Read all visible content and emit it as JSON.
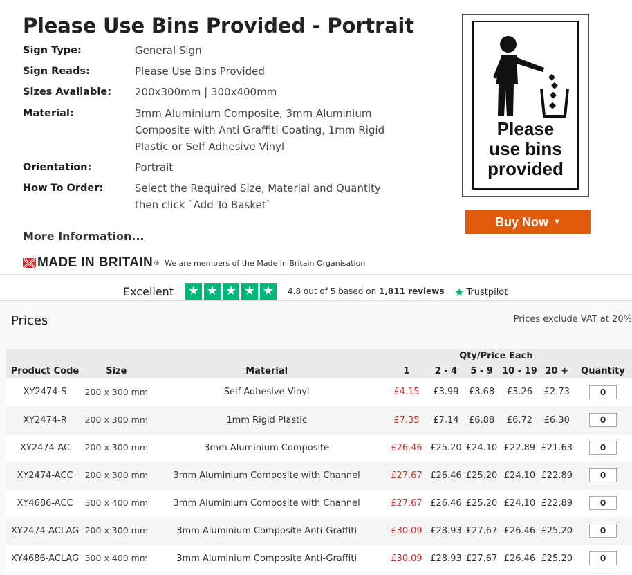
{
  "product": {
    "title": "Please Use Bins Provided - Portrait",
    "details": [
      {
        "label": "Sign Type:",
        "value": "General Sign"
      },
      {
        "label": "Sign Reads:",
        "value": "Please Use Bins Provided"
      },
      {
        "label": "Sizes Available:",
        "value": "200x300mm | 300x400mm"
      },
      {
        "label": "Material:",
        "value": "3mm Aluminium Composite, 3mm Aluminium Composite with Anti Graffiti Coating, 1mm Rigid Plastic or Self Adhesive Vinyl"
      },
      {
        "label": "Orientation:",
        "value": "Portrait"
      },
      {
        "label": "How To Order:",
        "value": "Select the Required Size, Material and Quantity then click `Add To Basket`"
      }
    ],
    "more_info": "More Information...",
    "sign_text_line1": "Please",
    "sign_text_line2": "use bins",
    "sign_text_line3": "provided",
    "buy_button": "Buy Now",
    "buy_icon": "caret-down-icon"
  },
  "made_in_britain": {
    "logo": "MADE IN BRITAIN",
    "reg": "®",
    "text": "We are members of the Made in Britain Organisation"
  },
  "trustpilot": {
    "rating_word": "Excellent",
    "stars": 5,
    "score_prefix": "4.8 out of 5 based on",
    "review_count": "1,811 reviews",
    "brand": "Trustpilot",
    "color": "#00b67a"
  },
  "prices": {
    "title": "Prices",
    "vat_note": "Prices exclude VAT at 20%",
    "group_header": "Qty/Price Each",
    "columns": [
      "Product Code",
      "Size",
      "Material",
      "1",
      "2 - 4",
      "5 - 9",
      "10 - 19",
      "20 +",
      "Quantity"
    ],
    "rows": [
      {
        "code": "XY2474-S",
        "size": "200 x 300 mm",
        "material": "Self Adhesive Vinyl",
        "p1": "£4.15",
        "p2": "£3.99",
        "p3": "£3.68",
        "p4": "£3.26",
        "p5": "£2.73",
        "qty": "0"
      },
      {
        "code": "XY2474-R",
        "size": "200 x 300 mm",
        "material": "1mm Rigid Plastic",
        "p1": "£7.35",
        "p2": "£7.14",
        "p3": "£6.88",
        "p4": "£6.72",
        "p5": "£6.30",
        "qty": "0"
      },
      {
        "code": "XY2474-AC",
        "size": "200 x 300 mm",
        "material": "3mm Aluminium Composite",
        "p1": "£26.46",
        "p2": "£25.20",
        "p3": "£24.10",
        "p4": "£22.89",
        "p5": "£21.63",
        "qty": "0"
      },
      {
        "code": "XY2474-ACC",
        "size": "200 x 300 mm",
        "material": "3mm Aluminium Composite with Channel",
        "p1": "£27.67",
        "p2": "£26.46",
        "p3": "£25.20",
        "p4": "£24.10",
        "p5": "£22.89",
        "qty": "0"
      },
      {
        "code": "XY4686-ACC",
        "size": "300 x 400 mm",
        "material": "3mm Aluminium Composite with Channel",
        "p1": "£27.67",
        "p2": "£26.46",
        "p3": "£25.20",
        "p4": "£24.10",
        "p5": "£22.89",
        "qty": "0"
      },
      {
        "code": "XY2474-ACLAG",
        "size": "200 x 300 mm",
        "material": "3mm Aluminium Composite Anti-Graffiti",
        "p1": "£30.09",
        "p2": "£28.93",
        "p3": "£27.67",
        "p4": "£26.46",
        "p5": "£25.20",
        "qty": "0"
      },
      {
        "code": "XY4686-ACLAG",
        "size": "300 x 400 mm",
        "material": "3mm Aluminium Composite Anti-Graffiti",
        "p1": "£30.09",
        "p2": "£28.93",
        "p3": "£27.67",
        "p4": "£26.46",
        "p5": "£25.20",
        "qty": "0"
      }
    ],
    "first_price_color": "#d32f2f"
  },
  "colors": {
    "buy_button": "#e05a0c",
    "trustpilot_green": "#00b67a",
    "made_in_britain_red": "#d32f2f"
  }
}
